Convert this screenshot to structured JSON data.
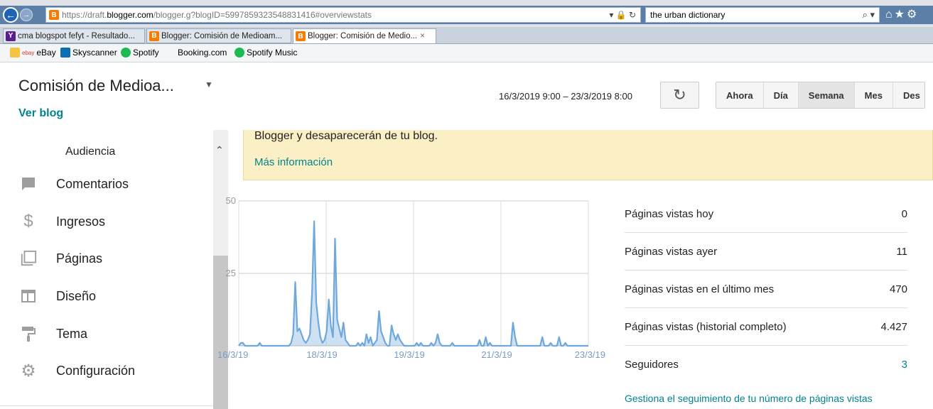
{
  "browser": {
    "url_prefix": "https://draft.",
    "url_domain": "blogger.com",
    "url_rest": "/blogger.g?blogID=5997859323548831416#overviewstats",
    "search_value": "the urban dictionary",
    "tabs": [
      {
        "label": "cma blogspot fefyt - Resultado..."
      },
      {
        "label": "Blogger: Comisión de Medioam..."
      },
      {
        "label": "Blogger: Comisión de Medio..."
      }
    ],
    "favorites": [
      {
        "label": "eBay"
      },
      {
        "label": "Skyscanner"
      },
      {
        "label": "Spotify"
      },
      {
        "label": "Booking.com"
      },
      {
        "label": "Spotify Music"
      }
    ]
  },
  "header": {
    "blog_title": "Comisión de Medioa...",
    "view_blog": "Ver blog",
    "date_range": "16/3/2019 9:00 – 23/3/2019 8:00",
    "periods": [
      "Ahora",
      "Día",
      "Semana",
      "Mes",
      "Des"
    ],
    "active_period": "Semana"
  },
  "sidebar": {
    "sub_item": "Audiencia",
    "items": [
      {
        "label": "Comentarios",
        "icon": "comment-icon"
      },
      {
        "label": "Ingresos",
        "icon": "dollar-icon"
      },
      {
        "label": "Páginas",
        "icon": "pages-icon"
      },
      {
        "label": "Diseño",
        "icon": "layout-icon"
      },
      {
        "label": "Tema",
        "icon": "paint-roller-icon"
      },
      {
        "label": "Configuración",
        "icon": "gear-icon"
      }
    ]
  },
  "notice": {
    "text": "Blogger y desaparecerán de tu blog.",
    "link": "Más información"
  },
  "stats": {
    "rows": [
      {
        "label": "Páginas vistas hoy",
        "value": "0"
      },
      {
        "label": "Páginas vistas ayer",
        "value": "11"
      },
      {
        "label": "Páginas vistas en el último mes",
        "value": "470"
      },
      {
        "label": "Páginas vistas (historial completo)",
        "value": "4.427"
      },
      {
        "label": "Seguidores",
        "value": "3"
      }
    ],
    "manage_link": "Gestiona el seguimiento de tu número de páginas vistas"
  },
  "chart_data": {
    "type": "area",
    "x_ticks": [
      "16/3/19",
      "18/3/19",
      "19/3/19",
      "21/3/19",
      "23/3/19"
    ],
    "y_ticks": [
      25,
      50
    ],
    "ylim": [
      0,
      50
    ],
    "x": [
      0,
      1,
      2,
      3,
      4,
      5,
      6,
      7,
      8,
      9,
      10,
      11,
      12,
      13,
      14,
      15,
      16,
      17,
      18,
      19,
      20,
      21,
      22,
      23,
      24,
      25,
      26,
      27,
      28,
      29,
      30,
      31,
      32,
      33,
      34,
      35,
      36,
      37,
      38,
      39,
      40,
      41,
      42,
      43,
      44,
      45,
      46,
      47,
      48,
      49,
      50,
      51,
      52,
      53,
      54,
      55,
      56,
      57,
      58,
      59,
      60,
      61,
      62,
      63,
      64,
      65,
      66,
      67,
      68,
      69,
      70,
      71,
      72,
      73,
      74,
      75,
      76,
      77,
      78,
      79,
      80,
      81,
      82,
      83,
      84,
      85,
      86,
      87,
      88,
      89,
      90,
      91,
      92,
      93,
      94,
      95,
      96,
      97,
      98,
      99,
      100,
      101,
      102,
      103,
      104,
      105,
      106,
      107,
      108,
      109,
      110,
      111,
      112,
      113,
      114,
      115,
      116,
      117,
      118,
      119,
      120,
      121,
      122,
      123,
      124,
      125,
      126,
      127,
      128,
      129,
      130,
      131,
      132,
      133,
      134,
      135,
      136,
      137,
      138,
      139,
      140,
      141,
      142,
      143,
      144,
      145,
      146,
      147,
      148,
      149,
      150,
      151,
      152,
      153,
      154,
      155,
      156,
      157,
      158,
      159,
      160,
      161,
      162,
      163,
      164,
      165,
      166,
      167
    ],
    "values": [
      0,
      1,
      1,
      0,
      0,
      0,
      0,
      0,
      0,
      0,
      1,
      0,
      0,
      0,
      0,
      0,
      0,
      0,
      0,
      0,
      0,
      0,
      0,
      0,
      0,
      1,
      4,
      22,
      5,
      6,
      4,
      2,
      1,
      2,
      4,
      18,
      43,
      15,
      8,
      3,
      1,
      2,
      5,
      16,
      7,
      3,
      37,
      9,
      6,
      3,
      8,
      2,
      1,
      0,
      0,
      0,
      0,
      1,
      0,
      1,
      0,
      4,
      1,
      3,
      0,
      1,
      2,
      12,
      5,
      3,
      1,
      0,
      0,
      7,
      4,
      2,
      4,
      2,
      1,
      0,
      0,
      0,
      0,
      0,
      0,
      1,
      0,
      1,
      0,
      0,
      0,
      0,
      1,
      0,
      1,
      4,
      1,
      0,
      0,
      0,
      0,
      0,
      1,
      0,
      0,
      0,
      0,
      0,
      0,
      0,
      0,
      0,
      0,
      0,
      0,
      2,
      0,
      0,
      3,
      0,
      1,
      0,
      0,
      0,
      0,
      0,
      0,
      0,
      0,
      0,
      0,
      8,
      3,
      0,
      0,
      0,
      0,
      0,
      0,
      0,
      0,
      0,
      0,
      0,
      0,
      3,
      0,
      0,
      0,
      1,
      0,
      0,
      0,
      3,
      0,
      0,
      1,
      0,
      0,
      0,
      0,
      0,
      0,
      0,
      0,
      0,
      0,
      0,
      0,
      0
    ],
    "grid": true,
    "color": "#6fa8dc"
  }
}
